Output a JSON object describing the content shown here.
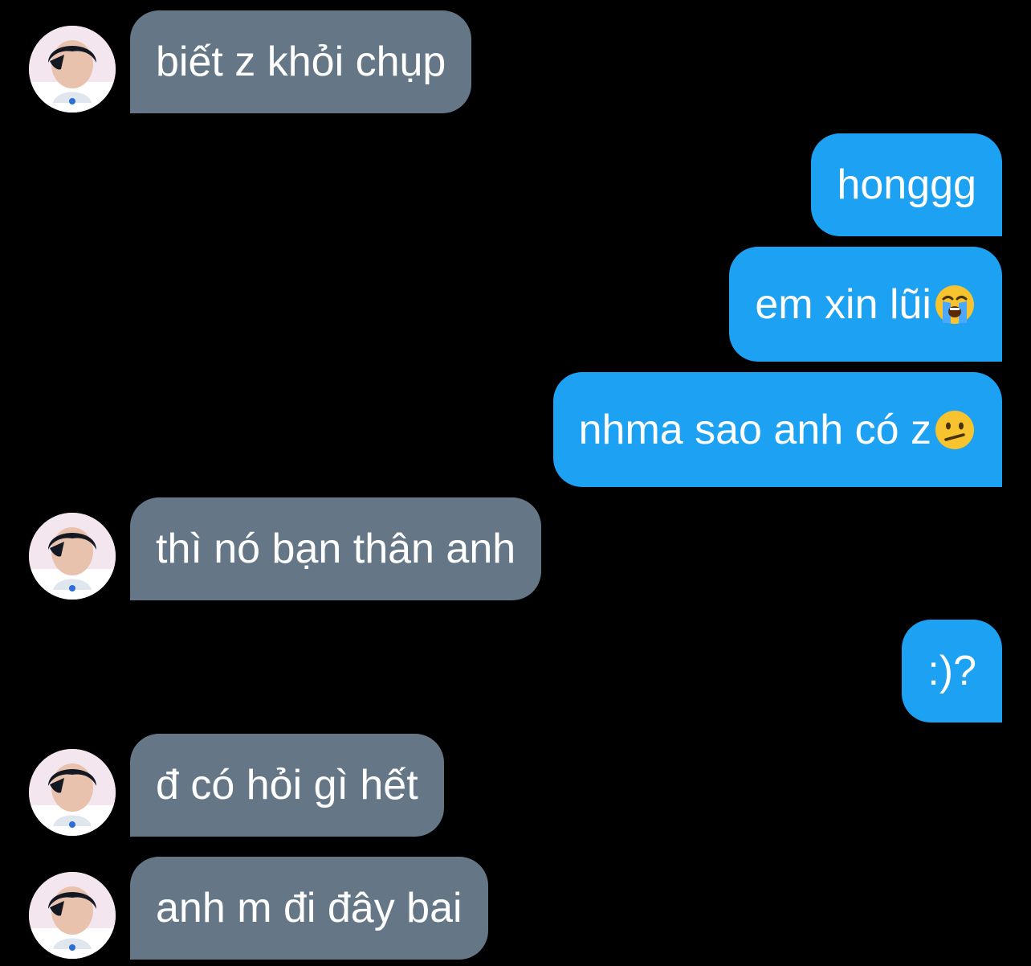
{
  "conversation": {
    "messages": [
      {
        "direction": "incoming",
        "text": "biết z khỏi chụp"
      },
      {
        "direction": "outgoing",
        "text": "honggg"
      },
      {
        "direction": "outgoing",
        "text": "em xin lũi",
        "emoji": "loudly-crying-face-emoji"
      },
      {
        "direction": "outgoing",
        "text": "nhma sao anh có z",
        "emoji": "confused-face-emoji"
      },
      {
        "direction": "incoming",
        "text": "thì nó bạn thân anh"
      },
      {
        "direction": "outgoing",
        "text": ":)?"
      },
      {
        "direction": "incoming",
        "text": "đ có hỏi gì hết"
      },
      {
        "direction": "incoming",
        "text": "anh m đi đây bai"
      }
    ]
  },
  "colors": {
    "background": "#000000",
    "incoming_bubble": "#657786",
    "outgoing_bubble": "#1da1f2",
    "text": "#ffffff"
  },
  "icons": {
    "avatar": "avatar-photo",
    "emoji_crying": "loudly-crying-face-emoji",
    "emoji_confused": "confused-face-emoji"
  }
}
